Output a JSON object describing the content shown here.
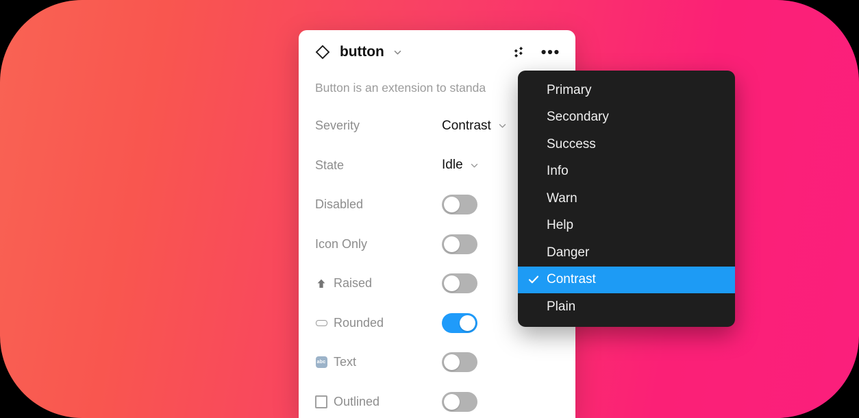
{
  "background": {
    "gradient_from": "#f96354",
    "gradient_to": "#fb1f7c"
  },
  "card": {
    "title": "button",
    "title_icon": "diamond-icon",
    "title_chevron_icon": "chevron-down-icon",
    "header_actions": [
      {
        "name": "sparkle-icon",
        "label": ""
      },
      {
        "name": "more-options-icon",
        "label": ""
      }
    ],
    "description": "Button is an extension to standa",
    "properties": [
      {
        "label": "Severity",
        "type": "select",
        "value": "Contrast",
        "icon": null
      },
      {
        "label": "State",
        "type": "select",
        "value": "Idle",
        "icon": null
      },
      {
        "label": "Disabled",
        "type": "toggle",
        "value": false,
        "icon": null
      },
      {
        "label": "Icon Only",
        "type": "toggle",
        "value": false,
        "icon": null
      },
      {
        "label": "Raised",
        "type": "toggle",
        "value": false,
        "icon": "arrow-up-icon"
      },
      {
        "label": "Rounded",
        "type": "toggle",
        "value": true,
        "icon": "rounded-pill-icon"
      },
      {
        "label": "Text",
        "type": "toggle",
        "value": false,
        "icon": "abc-icon"
      },
      {
        "label": "Outlined",
        "type": "toggle",
        "value": false,
        "icon": "square-outline-icon"
      }
    ]
  },
  "dropdown": {
    "selected": "Contrast",
    "check_icon": "check-icon",
    "highlight_color": "#1d9bf5",
    "items": [
      {
        "label": "Primary"
      },
      {
        "label": "Secondary"
      },
      {
        "label": "Success"
      },
      {
        "label": "Info"
      },
      {
        "label": "Warn"
      },
      {
        "label": "Help"
      },
      {
        "label": "Danger"
      },
      {
        "label": "Contrast"
      },
      {
        "label": "Plain"
      }
    ]
  },
  "abc_glyph": "abc"
}
